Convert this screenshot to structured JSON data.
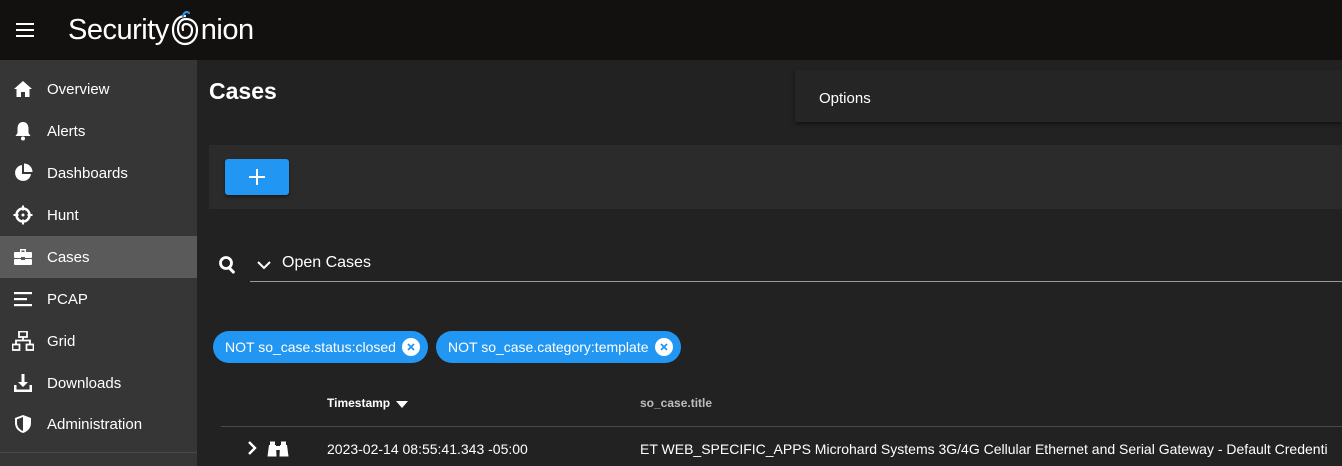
{
  "app": {
    "name": "Security Onion",
    "name_left": "Security",
    "name_right": "nion"
  },
  "sidebar": {
    "items": [
      {
        "label": "Overview",
        "icon": "home-icon"
      },
      {
        "label": "Alerts",
        "icon": "bell-icon"
      },
      {
        "label": "Dashboards",
        "icon": "pie-chart-icon"
      },
      {
        "label": "Hunt",
        "icon": "crosshairs-icon"
      },
      {
        "label": "Cases",
        "icon": "briefcase-icon",
        "active": true
      },
      {
        "label": "PCAP",
        "icon": "lines-icon"
      },
      {
        "label": "Grid",
        "icon": "network-icon"
      },
      {
        "label": "Downloads",
        "icon": "download-icon"
      },
      {
        "label": "Administration",
        "icon": "shield-icon"
      }
    ]
  },
  "page": {
    "title": "Cases"
  },
  "options": {
    "label": "Options"
  },
  "query": {
    "selected": "Open Cases"
  },
  "filters": [
    {
      "label": "NOT so_case.status:closed"
    },
    {
      "label": "NOT so_case.category:template"
    }
  ],
  "table": {
    "columns": [
      "Timestamp",
      "so_case.title"
    ],
    "rows": [
      {
        "timestamp": "2023-02-14 08:55:41.343 -05:00",
        "title": "ET WEB_SPECIFIC_APPS Microhard Systems 3G/4G Cellular Ethernet and Serial Gateway - Default Credenti"
      }
    ]
  },
  "colors": {
    "accent": "#2196f3",
    "topbar": "#121110",
    "sidebar": "#363636",
    "sidebar_active": "#5a5a5a"
  }
}
